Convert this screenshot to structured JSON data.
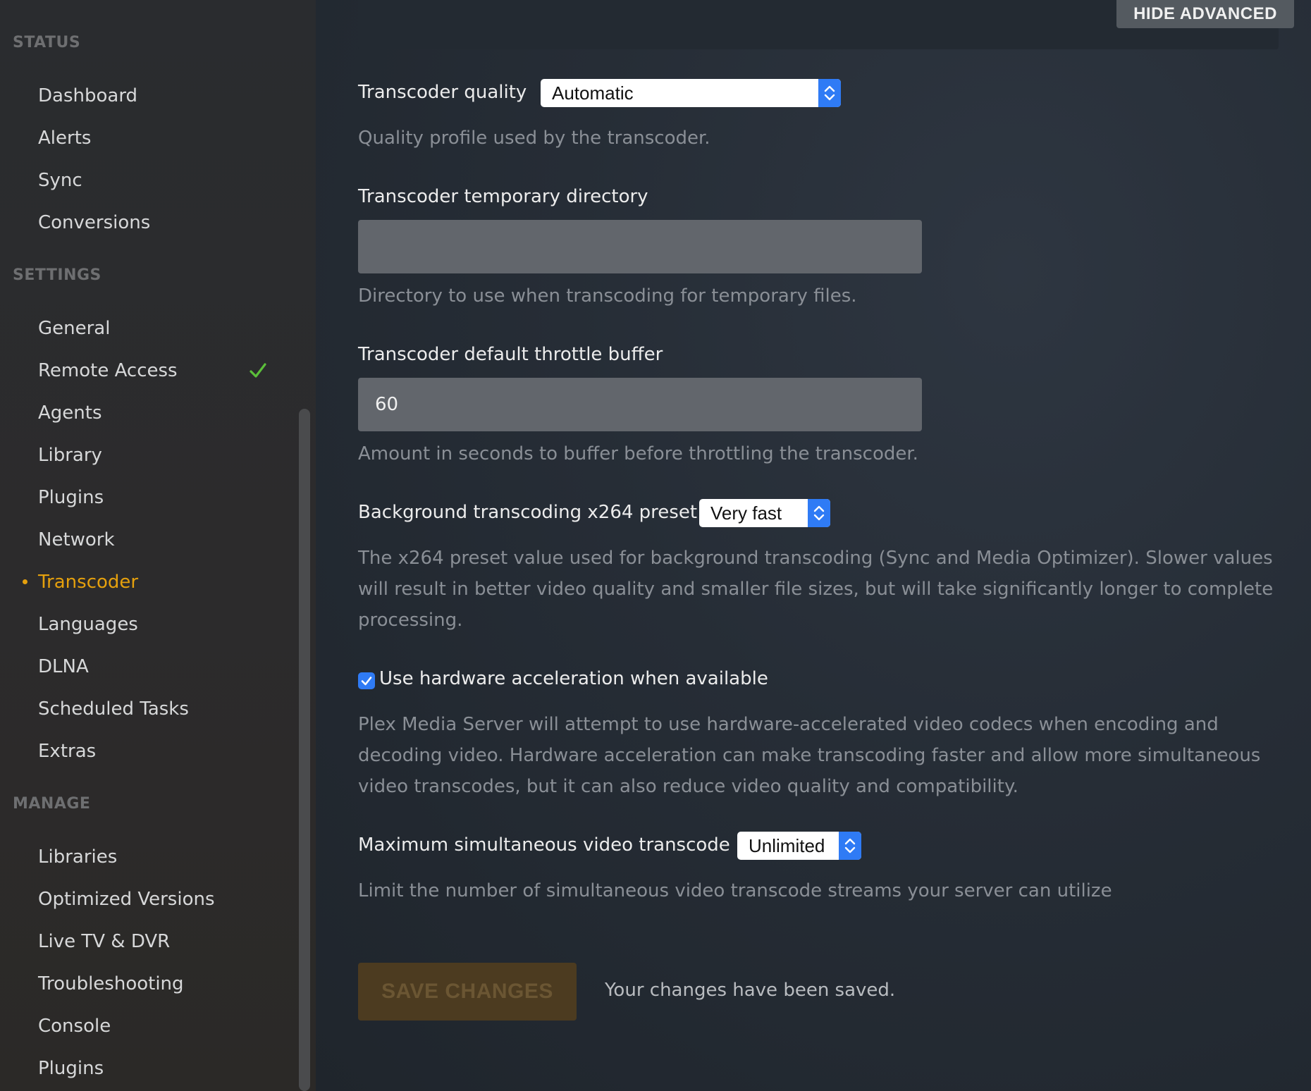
{
  "sidebar": {
    "sections": [
      {
        "title": "STATUS",
        "items": [
          "Dashboard",
          "Alerts",
          "Sync",
          "Conversions"
        ]
      },
      {
        "title": "SETTINGS",
        "items": [
          "General",
          "Remote Access",
          "Agents",
          "Library",
          "Plugins",
          "Network",
          "Transcoder",
          "Languages",
          "DLNA",
          "Scheduled Tasks",
          "Extras"
        ]
      },
      {
        "title": "MANAGE",
        "items": [
          "Libraries",
          "Optimized Versions",
          "Live TV & DVR",
          "Troubleshooting",
          "Console",
          "Plugins"
        ]
      }
    ],
    "active_item": "Transcoder",
    "remote_access_status_icon": "check-icon",
    "colors": {
      "active": "#e5a00d",
      "check": "#5bbf3a"
    }
  },
  "header": {
    "hide_advanced_label": "HIDE ADVANCED"
  },
  "settings": {
    "transcoder_quality": {
      "label": "Transcoder quality",
      "value": "Automatic",
      "help": "Quality profile used by the transcoder."
    },
    "temp_directory": {
      "label": "Transcoder temporary directory",
      "value": "",
      "help": "Directory to use when transcoding for temporary files."
    },
    "throttle_buffer": {
      "label": "Transcoder default throttle buffer",
      "value": "60",
      "help": "Amount in seconds to buffer before throttling the transcoder."
    },
    "x264_preset": {
      "label": "Background transcoding x264 preset",
      "value": "Very fast",
      "help": "The x264 preset value used for background transcoding (Sync and Media Optimizer). Slower values will result in better video quality and smaller file sizes, but will take significantly longer to complete processing."
    },
    "hardware_acceleration": {
      "label": "Use hardware acceleration when available",
      "checked": true,
      "help": "Plex Media Server will attempt to use hardware-accelerated video codecs when encoding and decoding video. Hardware acceleration can make transcoding faster and allow more simultaneous video transcodes, but it can also reduce video quality and compatibility."
    },
    "max_simultaneous": {
      "label": "Maximum simultaneous video transcode",
      "value": "Unlimited",
      "help": "Limit the number of simultaneous video transcode streams your server can utilize"
    }
  },
  "footer": {
    "save_label": "SAVE CHANGES",
    "saved_message": "Your changes have been saved."
  }
}
